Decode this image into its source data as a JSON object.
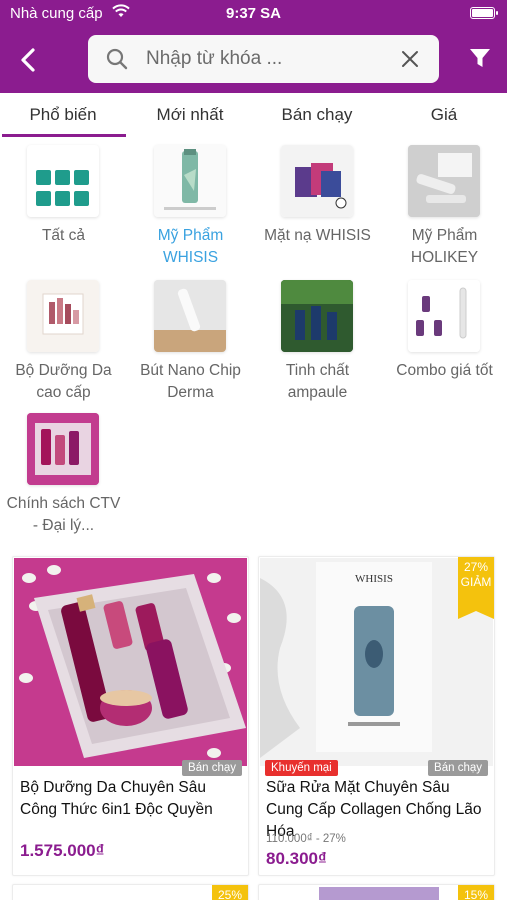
{
  "status_bar": {
    "carrier": "Nhà cung cấp",
    "time": "9:37 SA"
  },
  "search": {
    "placeholder": "Nhập từ khóa ...",
    "value": ""
  },
  "tabs": [
    {
      "label": "Phổ biến",
      "active": true
    },
    {
      "label": "Mới nhất",
      "active": false
    },
    {
      "label": "Bán chạy",
      "active": false
    },
    {
      "label": "Giá",
      "active": false
    }
  ],
  "categories": [
    {
      "label": "Tất cả",
      "highlighted": false,
      "icon": "grid-icon"
    },
    {
      "label": "Mỹ Phẩm WHISIS",
      "highlighted": true
    },
    {
      "label": "Mặt nạ WHISIS",
      "highlighted": false
    },
    {
      "label": "Mỹ Phẩm HOLIKEY",
      "highlighted": false
    },
    {
      "label": "Bộ Dưỡng Da cao cấp",
      "highlighted": false
    },
    {
      "label": "Bút Nano Chip Derma",
      "highlighted": false
    },
    {
      "label": "Tinh chất ampaule",
      "highlighted": false
    },
    {
      "label": "Combo giá tốt",
      "highlighted": false
    },
    {
      "label": "Chính sách CTV - Đại lý...",
      "highlighted": false
    }
  ],
  "products": [
    {
      "name": "Bộ Dưỡng Da Chuyên Sâu Công Thức 6in1 Độc Quyền",
      "price": "1.575.000₫",
      "old_price": "",
      "sold_badge": "Bán chạy",
      "promo_badge": "",
      "discount": ""
    },
    {
      "name": "Sữa Rửa Mặt Chuyên Sâu Cung Cấp Collagen Chống Lão Hóa",
      "price": "80.300₫",
      "old_price": "110.000₫ - 27%",
      "sold_badge": "Bán chạy",
      "promo_badge": "Khuyến mại",
      "discount": "27%",
      "discount_label": "GIẢM",
      "image_brand": "WHISIS"
    },
    {
      "discount": "25%"
    },
    {
      "discount": "15%"
    }
  ],
  "colors": {
    "brand": "#8b1c8f",
    "highlight": "#3aa2e0",
    "discount": "#f4c20d",
    "promo": "#e8302e"
  }
}
